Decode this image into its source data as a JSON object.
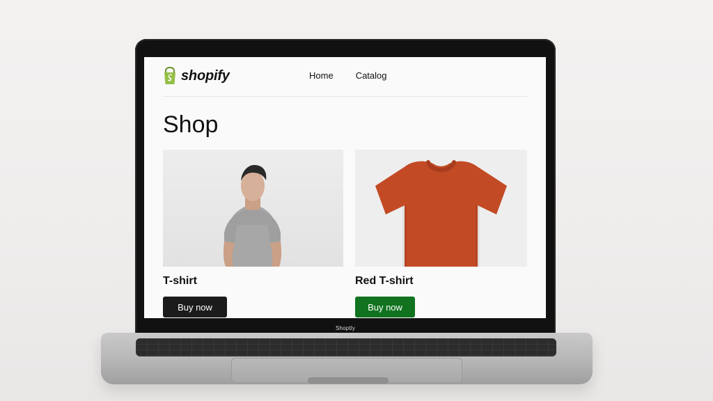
{
  "brand": {
    "name": "shopify",
    "accent": "#95BF47"
  },
  "laptop": {
    "label": "Shoptly"
  },
  "nav": {
    "items": [
      {
        "label": "Home"
      },
      {
        "label": "Catalog"
      }
    ]
  },
  "page": {
    "title": "Shop"
  },
  "products": [
    {
      "title": "T-shirt",
      "button_label": "Buy now",
      "button_color": "#1b1b1b"
    },
    {
      "title": "Red T-shirt",
      "button_label": "Buy now",
      "button_color": "#11731f"
    }
  ]
}
